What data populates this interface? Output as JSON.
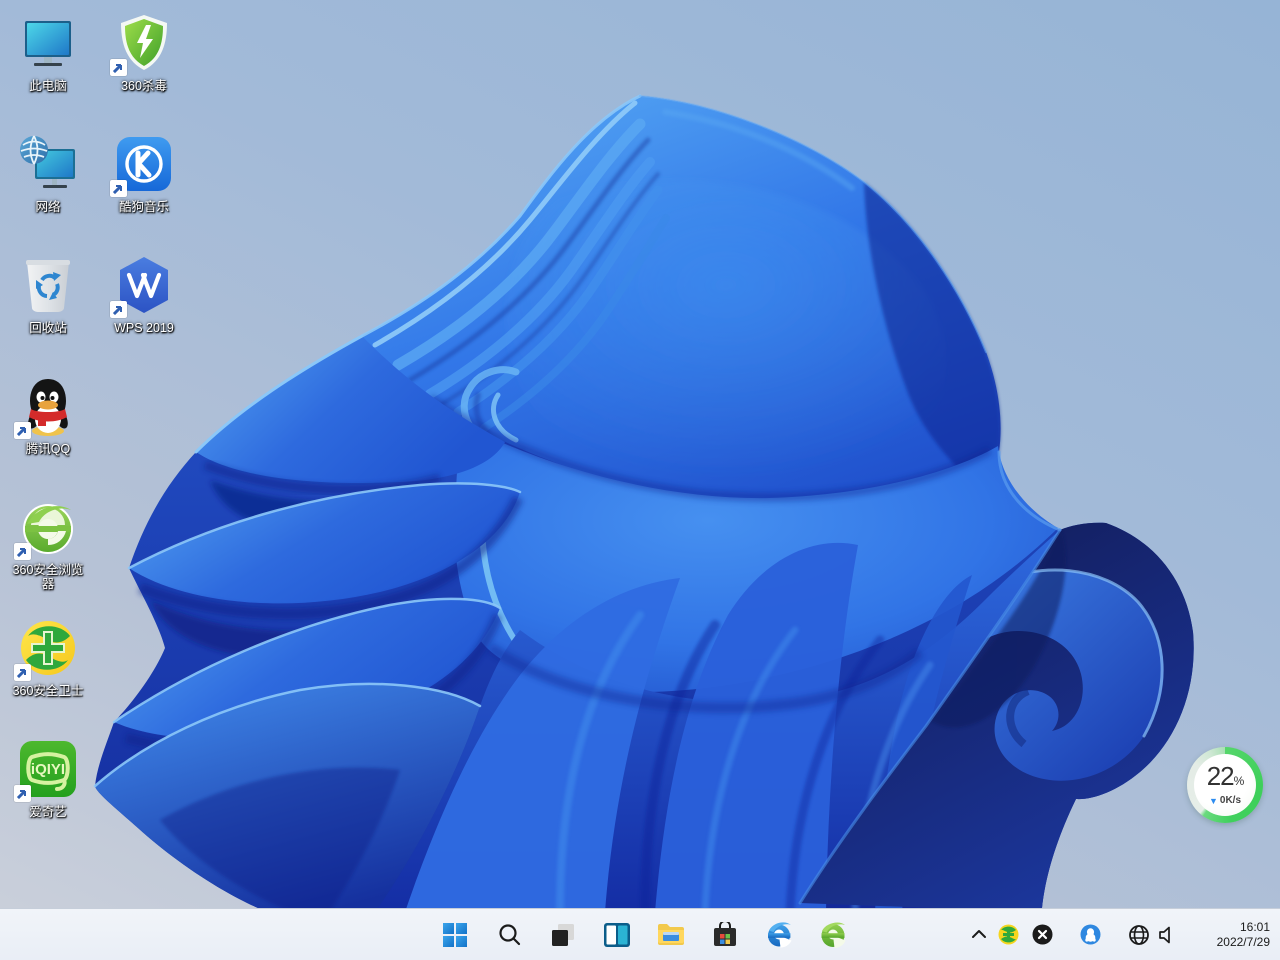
{
  "desktop": {
    "icons": [
      {
        "id": "this-pc",
        "label": "此电脑",
        "col": 0,
        "row": 0,
        "shortcut": false
      },
      {
        "id": "antivirus360",
        "label": "360杀毒",
        "col": 1,
        "row": 0,
        "shortcut": true
      },
      {
        "id": "network",
        "label": "网络",
        "col": 0,
        "row": 1,
        "shortcut": false
      },
      {
        "id": "kugou",
        "label": "酷狗音乐",
        "col": 1,
        "row": 1,
        "shortcut": true
      },
      {
        "id": "recycle-bin",
        "label": "回收站",
        "col": 0,
        "row": 2,
        "shortcut": false
      },
      {
        "id": "wps",
        "label": "WPS 2019",
        "col": 1,
        "row": 2,
        "shortcut": true
      },
      {
        "id": "qq",
        "label": "腾讯QQ",
        "col": 0,
        "row": 3,
        "shortcut": true
      },
      {
        "id": "browser360",
        "label": "360安全浏览器",
        "col": 0,
        "row": 4,
        "shortcut": true
      },
      {
        "id": "guard360",
        "label": "360安全卫士",
        "col": 0,
        "row": 5,
        "shortcut": true
      },
      {
        "id": "iqiyi",
        "label": "爱奇艺",
        "col": 0,
        "row": 6,
        "shortcut": true
      }
    ]
  },
  "taskbar": {
    "buttons": [
      {
        "id": "start",
        "name": "start-button"
      },
      {
        "id": "search",
        "name": "search-button"
      },
      {
        "id": "taskview",
        "name": "task-view-button"
      },
      {
        "id": "widgets",
        "name": "widgets-button"
      },
      {
        "id": "explorer",
        "name": "file-explorer-button"
      },
      {
        "id": "store",
        "name": "microsoft-store-button"
      },
      {
        "id": "ie",
        "name": "internet-explorer-button"
      },
      {
        "id": "browser360",
        "name": "browser-360-button"
      }
    ],
    "tray": [
      {
        "id": "chevron",
        "name": "tray-expand-chevron"
      },
      {
        "id": "guard",
        "name": "tray-360-guard-icon"
      },
      {
        "id": "blackx",
        "name": "tray-360-antivirus-icon"
      },
      {
        "id": "qq",
        "name": "tray-qq-icon"
      },
      {
        "id": "globe",
        "name": "tray-network-icon"
      },
      {
        "id": "speaker",
        "name": "tray-volume-icon"
      }
    ],
    "clock": {
      "time": "16:01",
      "date": "2022/7/29"
    }
  },
  "speedball": {
    "percent": "22",
    "percent_unit": "%",
    "speed": "0K/s"
  },
  "colors": {
    "taskbar_bg": "#eef2f8",
    "wallpaper_top": "#96b4d6",
    "wallpaper_bottom": "#ccd1db",
    "bloom_deep": "#0b2296",
    "bloom_azure": "#2e73e8",
    "bloom_light": "#5fa8f4"
  }
}
